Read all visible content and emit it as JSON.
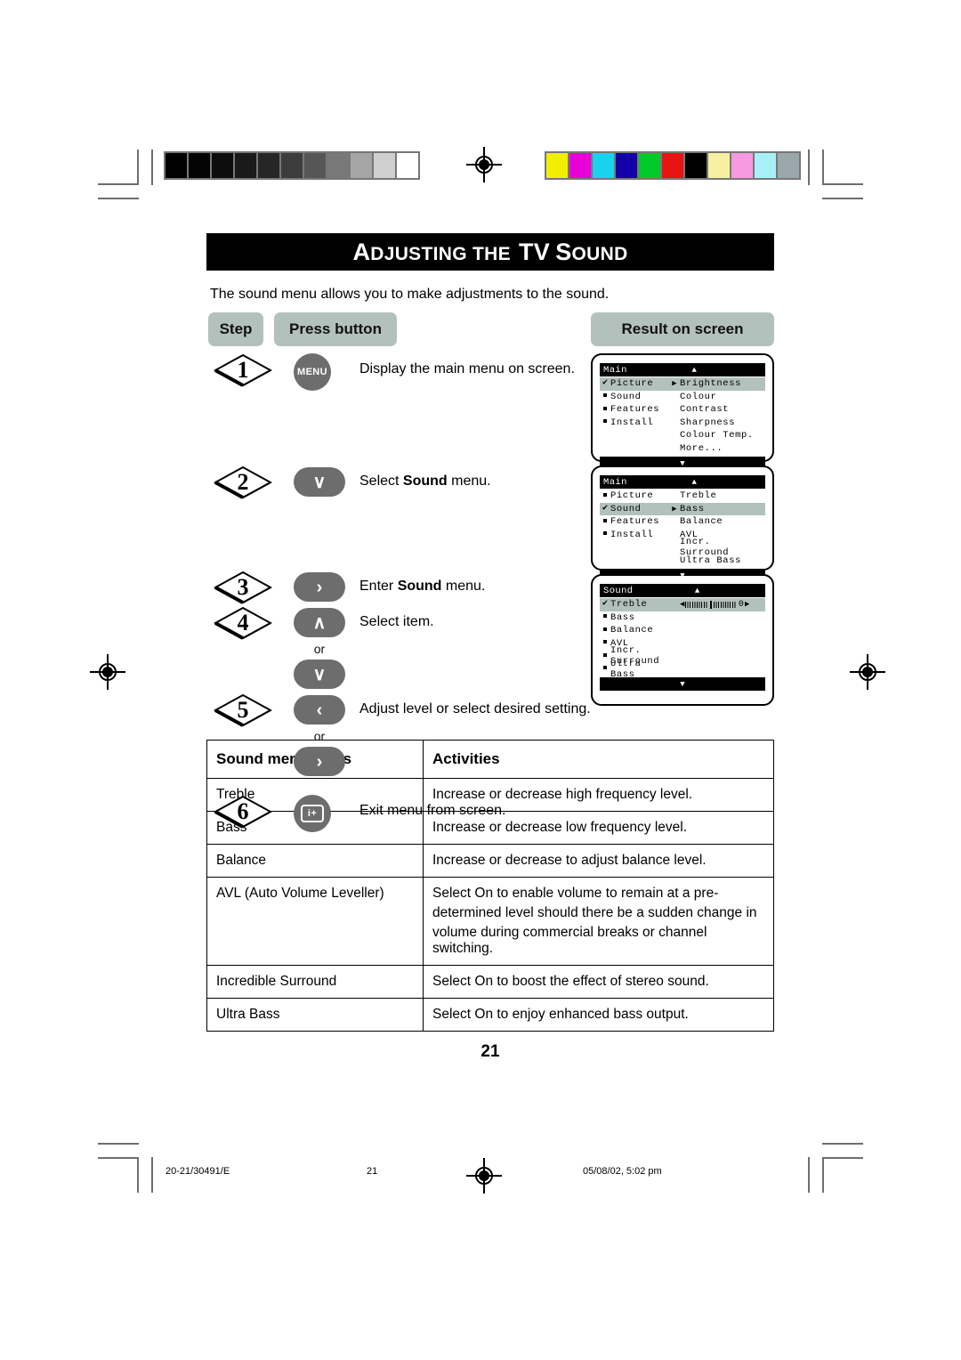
{
  "header": {
    "title_part1": "Adjusting the",
    "title_part2": "TV Sound",
    "intro": "The sound menu allows you to make adjustments to the sound."
  },
  "column_headers": {
    "step": "Step",
    "press_button": "Press button",
    "result": "Result on screen"
  },
  "steps": [
    {
      "number": "1",
      "button": "MENU",
      "button_icon": "menu-button",
      "text": "Display the main menu on screen."
    },
    {
      "number": "2",
      "button": "∨",
      "button_icon": "chevron-down-icon",
      "text_before": "Select ",
      "text_bold": "Sound",
      "text_after": " menu."
    },
    {
      "number": "3",
      "button": "›",
      "button_icon": "chevron-right-icon",
      "text_before": "Enter ",
      "text_bold": "Sound",
      "text_after": " menu."
    },
    {
      "number": "4",
      "button": "∧",
      "button_icon": "chevron-up-icon",
      "button2": "∨",
      "button2_icon": "chevron-down-icon",
      "or_label": "or",
      "text": "Select item."
    },
    {
      "number": "5",
      "button": "‹",
      "button_icon": "chevron-left-icon",
      "button2": "›",
      "button2_icon": "chevron-right-icon",
      "or_label": "or",
      "text": "Adjust level or select desired setting."
    },
    {
      "number": "6",
      "button": "i+",
      "button_icon": "info-exit-icon",
      "text": "Exit menu from screen."
    }
  ],
  "screens": [
    {
      "title": "Main",
      "up_arrow": "▲",
      "down_arrow": "▼",
      "left_items": [
        {
          "mark": "check",
          "label": "Picture",
          "selected": true,
          "pointer": "▶"
        },
        {
          "mark": "square",
          "label": "Sound",
          "selected": false,
          "pointer": ""
        },
        {
          "mark": "square",
          "label": "Features",
          "selected": false,
          "pointer": ""
        },
        {
          "mark": "square",
          "label": "Install",
          "selected": false,
          "pointer": ""
        }
      ],
      "right_items": [
        "Brightness",
        "Colour",
        "Contrast",
        "Sharpness",
        "Colour Temp.",
        "More..."
      ]
    },
    {
      "title": "Main",
      "up_arrow": "▲",
      "down_arrow": "▼",
      "left_items": [
        {
          "mark": "square",
          "label": "Picture",
          "selected": false,
          "pointer": ""
        },
        {
          "mark": "check",
          "label": "Sound",
          "selected": true,
          "pointer": "▶"
        },
        {
          "mark": "square",
          "label": "Features",
          "selected": false,
          "pointer": ""
        },
        {
          "mark": "square",
          "label": "Install",
          "selected": false,
          "pointer": ""
        }
      ],
      "right_items": [
        "Treble",
        "Bass",
        "Balance",
        "AVL",
        "Incr. Surround",
        "Ultra Bass"
      ]
    },
    {
      "title": "Sound",
      "up_arrow": "▲",
      "down_arrow": "▼",
      "left_items": [
        {
          "mark": "check",
          "label": "Treble",
          "selected": true,
          "slider": true
        },
        {
          "mark": "square",
          "label": "Bass",
          "selected": false
        },
        {
          "mark": "square",
          "label": "Balance",
          "selected": false
        },
        {
          "mark": "square",
          "label": "AVL",
          "selected": false
        },
        {
          "mark": "square",
          "label": "Incr. Surround",
          "selected": false
        },
        {
          "mark": "square",
          "label": "Ultra Bass",
          "selected": false
        }
      ],
      "right_items": [],
      "slider": {
        "left_arrow": "◀",
        "right_arrow": "▶",
        "value": "0"
      }
    }
  ],
  "table": {
    "headers": [
      "Sound menu items",
      "Activities"
    ],
    "rows": [
      {
        "item": "Treble",
        "activity": [
          "Increase or decrease high frequency level."
        ]
      },
      {
        "item": "Bass",
        "activity": [
          "Increase or decrease low frequency level."
        ]
      },
      {
        "item": "Balance",
        "activity": [
          "Increase or decrease to adjust balance level."
        ]
      },
      {
        "item": "AVL (Auto Volume Leveller)",
        "activity": [
          "Select On to enable volume to remain at a pre-",
          "determined level should there be a sudden change in",
          "volume during commercial breaks or channel switching."
        ]
      },
      {
        "item": "Incredible Surround",
        "activity": [
          "Select On to boost the effect of stereo sound."
        ]
      },
      {
        "item": "Ultra Bass",
        "activity": [
          "Select On to enjoy enhanced bass output."
        ]
      }
    ]
  },
  "page_number": "21",
  "footer": {
    "doc_code": "20-21/30491/E",
    "page": "21",
    "timestamp": "05/08/02, 5:02 pm"
  },
  "calibration": {
    "grayscale": [
      "#000000",
      "#040404",
      "#0d0d0d",
      "#1a1a1a",
      "#262626",
      "#3d3d3d",
      "#565656",
      "#787878",
      "#a5a5a5",
      "#cfcfcf",
      "#ffffff"
    ],
    "colors": [
      "#f2ee00",
      "#e800d8",
      "#18d2ee",
      "#1400a8",
      "#00c92a",
      "#e81414",
      "#000000",
      "#f6f0a0",
      "#f79ae2",
      "#a8f0f7",
      "#9aa8ab"
    ]
  }
}
